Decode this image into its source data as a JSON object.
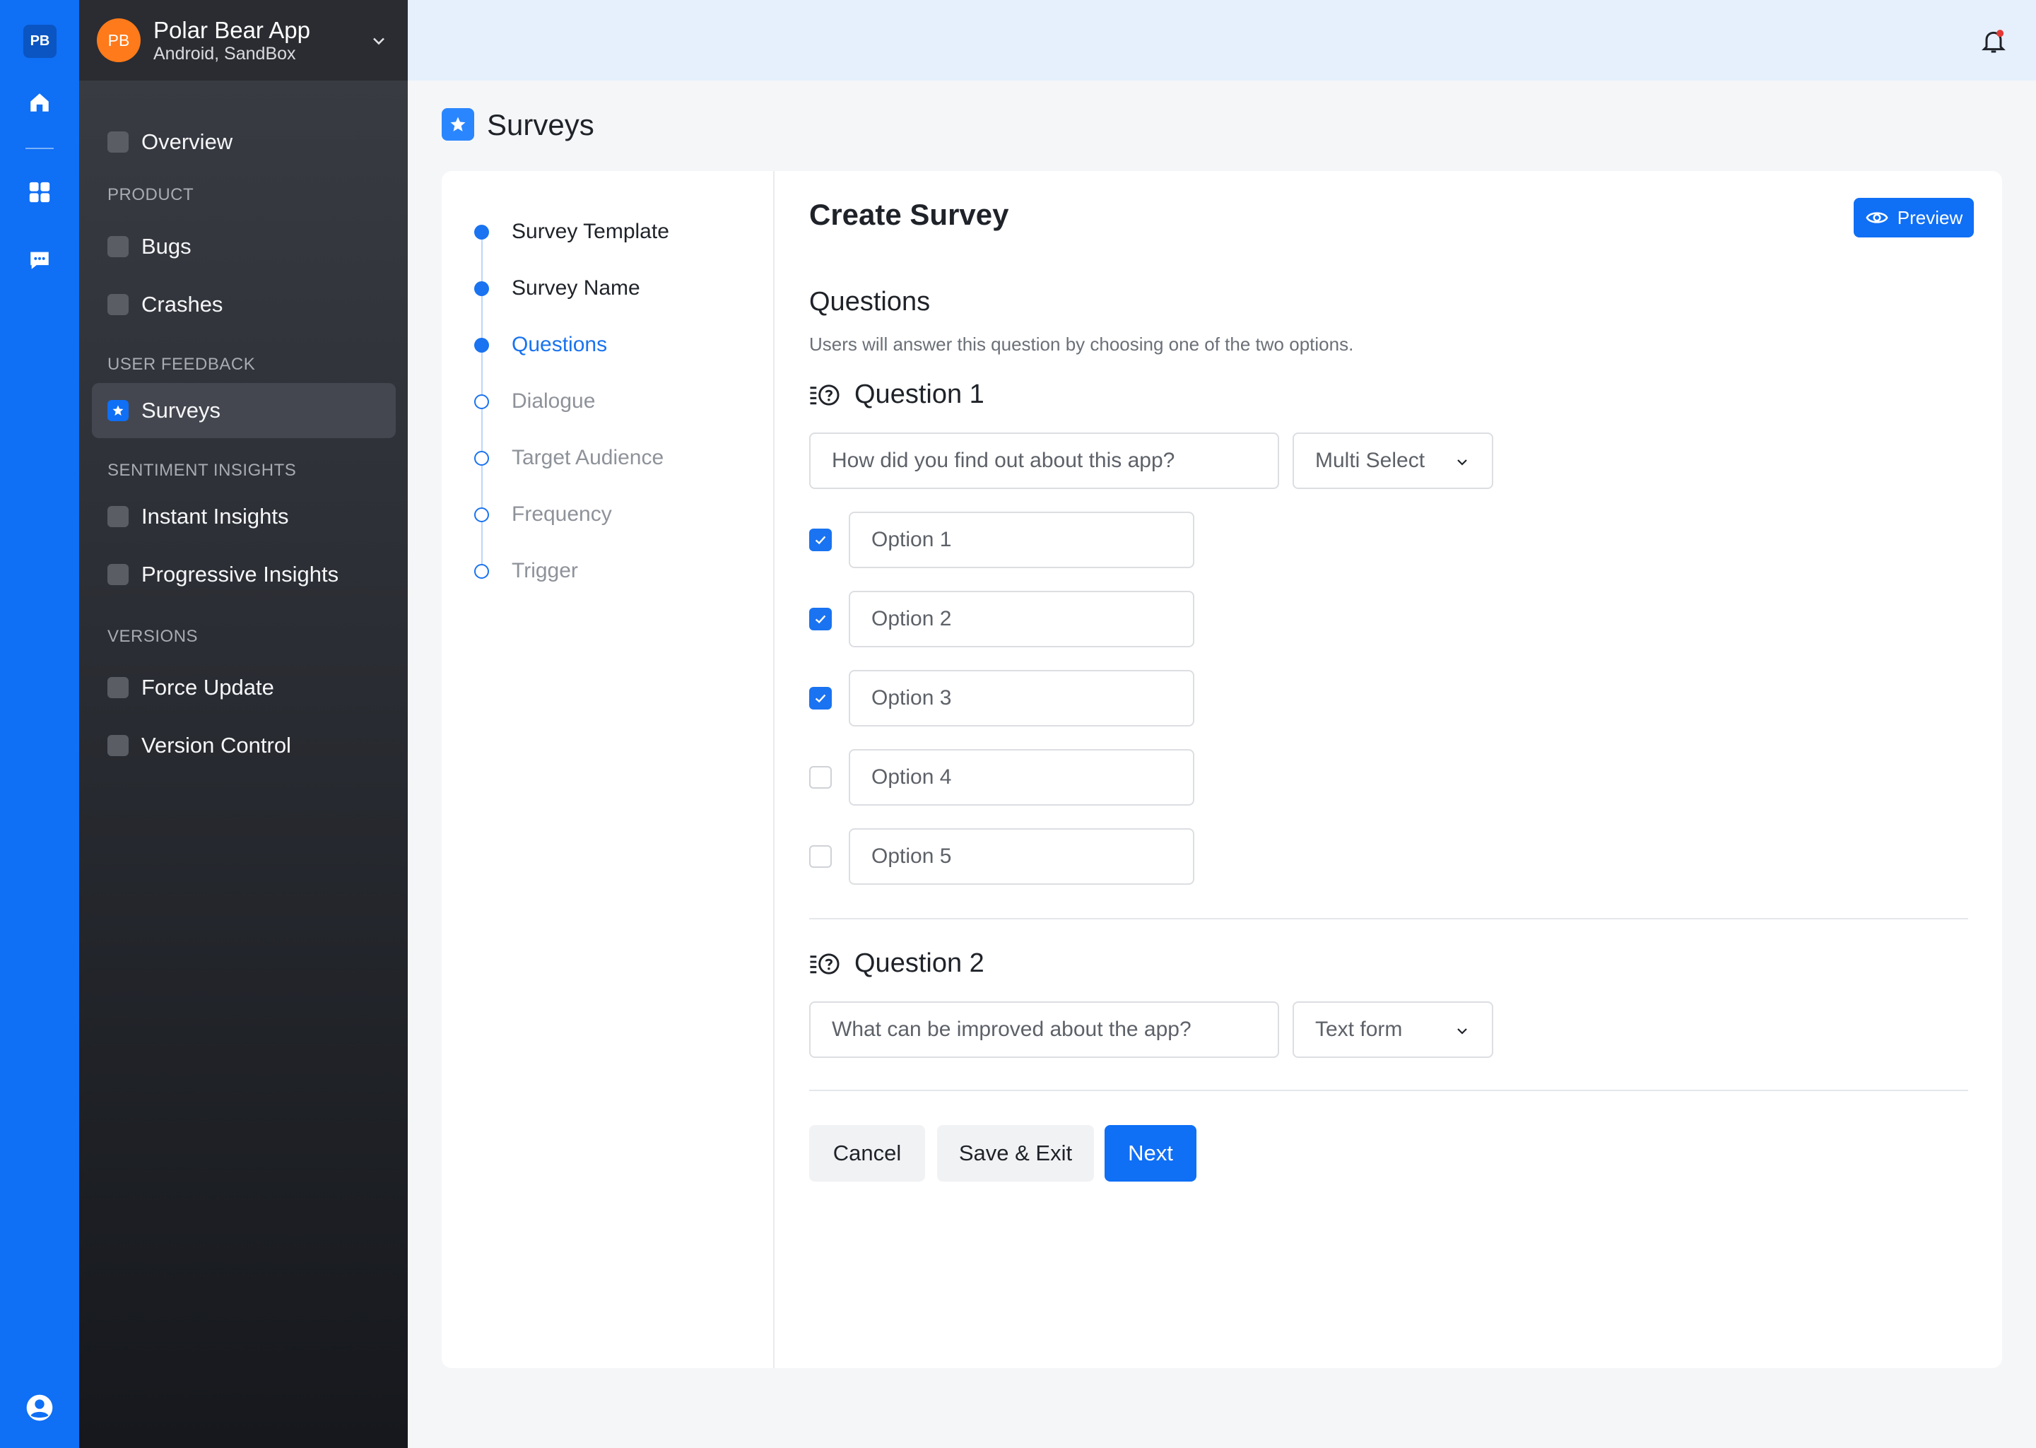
{
  "rail": {
    "logo": "PB",
    "icons": [
      "home-icon",
      "grid-icon",
      "chat-icon",
      "user-icon"
    ]
  },
  "app": {
    "avatar": "PB",
    "name": "Polar Bear App",
    "subtitle": "Android, SandBox"
  },
  "sidebar": {
    "overview": "Overview",
    "sections": {
      "product": "PRODUCT",
      "user_feedback": "USER FEEDBACK",
      "sentiment": "SENTIMENT INSIGHTS",
      "versions": "VERSIONS"
    },
    "items": {
      "bugs": "Bugs",
      "crashes": "Crashes",
      "surveys": "Surveys",
      "instant": "Instant Insights",
      "progressive": "Progressive Insights",
      "force_update": "Force Update",
      "version_control": "Version Control"
    },
    "active_item": "Surveys"
  },
  "page": {
    "title": "Surveys"
  },
  "steps": [
    {
      "label": "Survey Template",
      "state": "done"
    },
    {
      "label": "Survey Name",
      "state": "done"
    },
    {
      "label": "Questions",
      "state": "current"
    },
    {
      "label": "Dialogue",
      "state": "todo"
    },
    {
      "label": "Target Audience",
      "state": "todo"
    },
    {
      "label": "Frequency",
      "state": "todo"
    },
    {
      "label": "Trigger",
      "state": "todo"
    }
  ],
  "form": {
    "title": "Create Survey",
    "preview_label": "Preview",
    "section_title": "Questions",
    "section_desc": "Users will answer this question by choosing one of the two options.",
    "q1": {
      "title": "Question 1",
      "placeholder": "How did you find out about this app?",
      "type": "Multi Select",
      "options": [
        {
          "label": "Option 1",
          "checked": true
        },
        {
          "label": "Option 2",
          "checked": true
        },
        {
          "label": "Option 3",
          "checked": true
        },
        {
          "label": "Option 4",
          "checked": false
        },
        {
          "label": "Option 5",
          "checked": false
        }
      ]
    },
    "q2": {
      "title": "Question 2",
      "placeholder": "What can be improved about the app?",
      "type": "Text form"
    },
    "buttons": {
      "cancel": "Cancel",
      "save_exit": "Save & Exit",
      "next": "Next"
    }
  },
  "colors": {
    "accent": "#0f6ff5",
    "rail": "#0f6ff5",
    "avatar": "#ff7a1a",
    "notification_dot": "#e53935"
  }
}
